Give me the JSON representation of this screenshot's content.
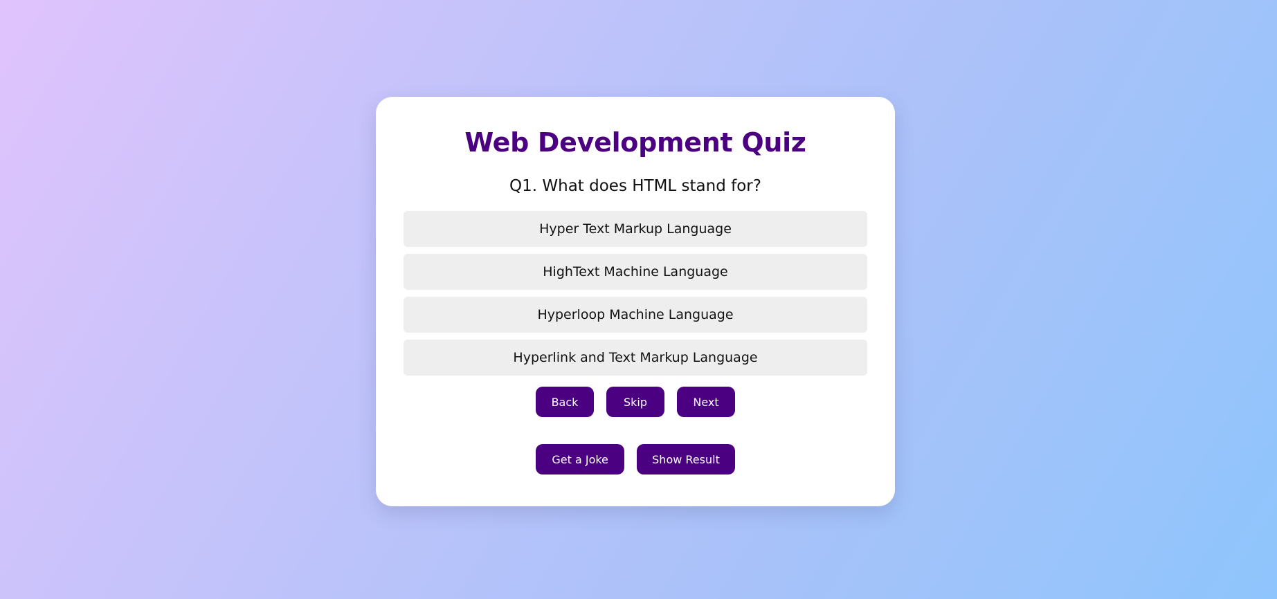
{
  "quiz": {
    "title": "Web Development Quiz",
    "question": "Q1. What does HTML stand for?",
    "options": [
      "Hyper Text Markup Language",
      "HighText Machine Language",
      "Hyperloop Machine Language",
      "Hyperlink and Text Markup Language"
    ],
    "nav": {
      "back_label": "Back",
      "skip_label": "Skip",
      "next_label": "Next"
    },
    "extras": {
      "joke_label": "Get a Joke",
      "result_label": "Show Result"
    }
  },
  "colors": {
    "accent": "#4b0082",
    "option_bg": "#eeeeee",
    "card_bg": "#ffffff"
  }
}
